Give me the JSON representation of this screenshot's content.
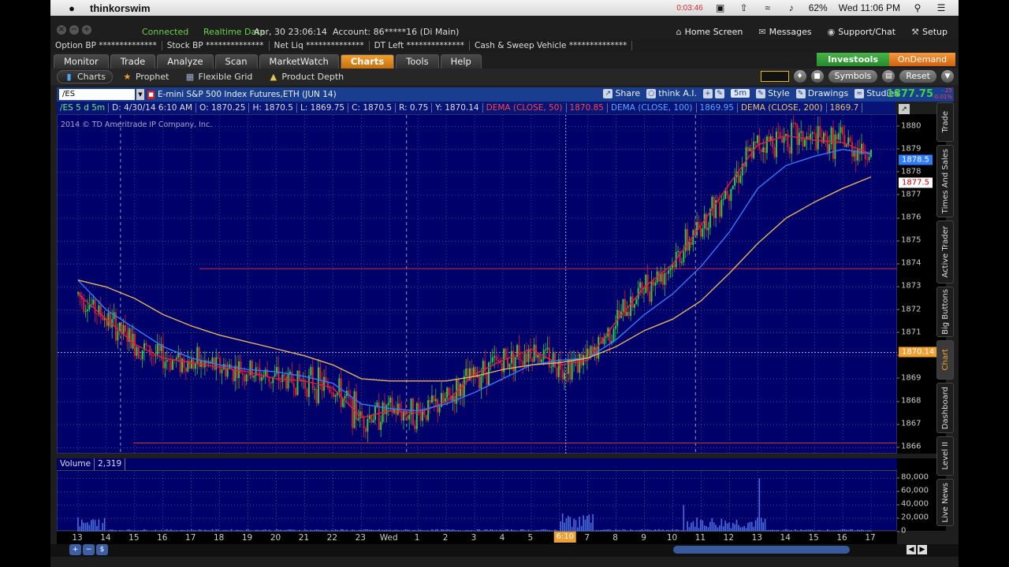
{
  "menubar": {
    "app_name": "thinkorswim",
    "timer": "0:03:46",
    "battery": "62%",
    "clock": "Wed 11:06 PM"
  },
  "status": {
    "connected": "Connected",
    "realtime": "Realtime Data",
    "datetime": "Apr, 30  23:06:14",
    "account": "Account: 86*****16 (Di Main)",
    "links": [
      "Home Screen",
      "Messages",
      "Support/Chat",
      "Setup"
    ]
  },
  "bp": [
    "Option BP  **************",
    "Stock BP  **************",
    "Net Liq  **************",
    "DT Left  **************",
    "Cash & Sweep Vehicle  **************"
  ],
  "tabs": {
    "items": [
      "Monitor",
      "Trade",
      "Analyze",
      "Scan",
      "MarketWatch",
      "Charts",
      "Tools",
      "Help"
    ],
    "active": "Charts",
    "investools": "Investools",
    "ondemand": "OnDemand"
  },
  "subtools": {
    "items": [
      "Charts",
      "Prophet",
      "Flexible Grid",
      "Product Depth"
    ],
    "symbols": "Symbols",
    "reset": "Reset"
  },
  "chart_header": {
    "symbol": "/ES",
    "description": "E-mini S&P 500 Index Futures,ETH (JUN 14)",
    "buttons": [
      "Share",
      "think A.I.",
      "Style",
      "Drawings",
      "Studies"
    ],
    "aggregation": "5m",
    "last": "1877.75",
    "net_change": [
      "-.25",
      "-0.01%"
    ]
  },
  "study_line": {
    "sym": "/ES 5 d 5m",
    "date": "D: 4/30/14 6:10 AM",
    "open": "O: 1870.25",
    "high": "H: 1870.5",
    "low": "L: 1869.75",
    "close": "C: 1870.5",
    "range": "R: 0.75",
    "y": "Y: 1870.14",
    "dema50": "DEMA (CLOSE, 50)",
    "dema50_val": "1870.85",
    "dema100": "DEMA (CLOSE, 100)",
    "dema100_val": "1869.95",
    "dema200": "DEMA (CLOSE, 200)",
    "dema200_val": "1869.7"
  },
  "copyright": "2014 © TD Ameritrade IP Company, Inc.",
  "price_axis": {
    "ticks": [
      "1880",
      "1879",
      "1878",
      "1877",
      "1876",
      "1875",
      "1874",
      "1873",
      "1872",
      "1871",
      "1870",
      "1869",
      "1868",
      "1867",
      "1866"
    ],
    "tags": {
      "blue": "1878.5",
      "white": "1877.5",
      "orange": "1870.14"
    }
  },
  "volume": {
    "label": "Volume",
    "value": "2,319",
    "ticks": [
      "80,000",
      "60,000",
      "40,000",
      "20,000",
      "0"
    ]
  },
  "x_axis": {
    "labels": [
      "13",
      "14",
      "15",
      "16",
      "17",
      "18",
      "19",
      "20",
      "21",
      "22",
      "23",
      "Wed",
      "1",
      "2",
      "3",
      "4",
      "5",
      "6",
      "7",
      "8",
      "9",
      "10",
      "11",
      "12",
      "13",
      "14",
      "15",
      "16",
      "17"
    ],
    "cross": "6:10"
  },
  "side_tabs": [
    "Trade",
    "Times And Sales",
    "Active Trader",
    "Big Buttons",
    "Chart",
    "Dashboard",
    "Level II",
    "Live News"
  ],
  "colors": {
    "plot_bg": "#00006a",
    "up": "#2ecc40",
    "down": "#e21b2e",
    "dema50": "#e4213a",
    "dema100": "#2f7dff",
    "dema200": "#e9b25c"
  },
  "chart_data": {
    "type": "line",
    "x": [
      "13",
      "14",
      "15",
      "16",
      "17",
      "18",
      "19",
      "20",
      "21",
      "22",
      "23",
      "Wed",
      "1",
      "2",
      "3",
      "4",
      "5",
      "6",
      "7",
      "8",
      "9",
      "10",
      "11",
      "12",
      "13",
      "14",
      "15",
      "16",
      "17"
    ],
    "ylim": [
      1865.7,
      1880.5
    ],
    "series": [
      {
        "name": "DEMA (CLOSE, 50)",
        "color": "#e4213a",
        "values": [
          1872.7,
          1871.6,
          1870.5,
          1869.9,
          1869.7,
          1869.5,
          1869.3,
          1869.0,
          1868.9,
          1868.6,
          1867.3,
          1867.6,
          1867.5,
          1868.0,
          1869.2,
          1869.8,
          1870.3,
          1869.6,
          1869.8,
          1871.5,
          1873.0,
          1874.0,
          1875.7,
          1877.5,
          1879.2,
          1879.6,
          1879.4,
          1879.3,
          1878.8
        ]
      },
      {
        "name": "DEMA (CLOSE, 100)",
        "color": "#2f7dff",
        "values": [
          1873.3,
          1872.0,
          1871.2,
          1870.4,
          1869.9,
          1869.6,
          1869.4,
          1869.3,
          1869.1,
          1868.8,
          1867.9,
          1867.7,
          1867.6,
          1867.9,
          1868.4,
          1869.0,
          1869.6,
          1869.8,
          1869.9,
          1870.7,
          1871.8,
          1872.7,
          1873.9,
          1875.4,
          1877.3,
          1878.3,
          1878.7,
          1879.0,
          1878.8
        ]
      },
      {
        "name": "DEMA (CLOSE, 200)",
        "color": "#e9b25c",
        "values": [
          1873.3,
          1873.0,
          1872.5,
          1871.8,
          1871.3,
          1870.9,
          1870.6,
          1870.3,
          1870.0,
          1869.6,
          1869.0,
          1868.9,
          1868.9,
          1868.9,
          1869.1,
          1869.4,
          1869.6,
          1869.7,
          1869.9,
          1870.4,
          1871.1,
          1871.6,
          1872.4,
          1873.6,
          1874.9,
          1876.0,
          1876.7,
          1877.3,
          1877.8
        ]
      }
    ],
    "volume_ylim": [
      0,
      90000
    ]
  }
}
